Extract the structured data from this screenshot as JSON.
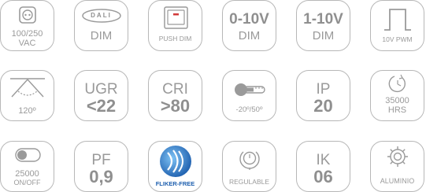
{
  "tiles": [
    {
      "id": "voltage",
      "lines": [
        "100/250",
        "VAC"
      ],
      "icon": "socket-icon"
    },
    {
      "id": "dali",
      "lines": [
        "DALI",
        "DIM"
      ],
      "icon": "dali-badge-icon"
    },
    {
      "id": "pushdim",
      "lines": [
        "PUSH DIM"
      ],
      "icon": "push-switch-icon"
    },
    {
      "id": "0-10v",
      "lines": [
        "0-10V",
        "DIM"
      ]
    },
    {
      "id": "1-10v",
      "lines": [
        "1-10V",
        "DIM"
      ]
    },
    {
      "id": "pwm",
      "lines": [
        "10V PWM"
      ],
      "icon": "pwm-wave-icon"
    },
    {
      "id": "angle",
      "lines": [
        "120º"
      ],
      "icon": "beam-angle-icon"
    },
    {
      "id": "ugr",
      "lines": [
        "UGR",
        "<22"
      ]
    },
    {
      "id": "cri",
      "lines": [
        "CRI",
        ">80"
      ]
    },
    {
      "id": "temp",
      "lines": [
        "-20º/50º"
      ],
      "icon": "thermometer-icon"
    },
    {
      "id": "ip",
      "lines": [
        "IP",
        "20"
      ]
    },
    {
      "id": "hours",
      "lines": [
        "35000",
        "HRS"
      ],
      "icon": "clock-icon"
    },
    {
      "id": "onoff",
      "lines": [
        "25000",
        "ON/OFF"
      ],
      "icon": "toggle-switch-icon"
    },
    {
      "id": "pf",
      "lines": [
        "PF",
        "0,9"
      ]
    },
    {
      "id": "flicker",
      "lines": [
        "FLIKER-FREE"
      ],
      "icon": "flicker-free-icon"
    },
    {
      "id": "dimmable",
      "lines": [
        "REGULABLE"
      ],
      "icon": "dimmer-knob-icon"
    },
    {
      "id": "ik",
      "lines": [
        "IK",
        "06"
      ]
    },
    {
      "id": "material",
      "lines": [
        "ALUMINIO"
      ],
      "icon": "gear-icon"
    }
  ],
  "colors": {
    "border": "#b7b7b7",
    "text": "#9a9a9a",
    "flicker_blue": "#1e5fae"
  }
}
